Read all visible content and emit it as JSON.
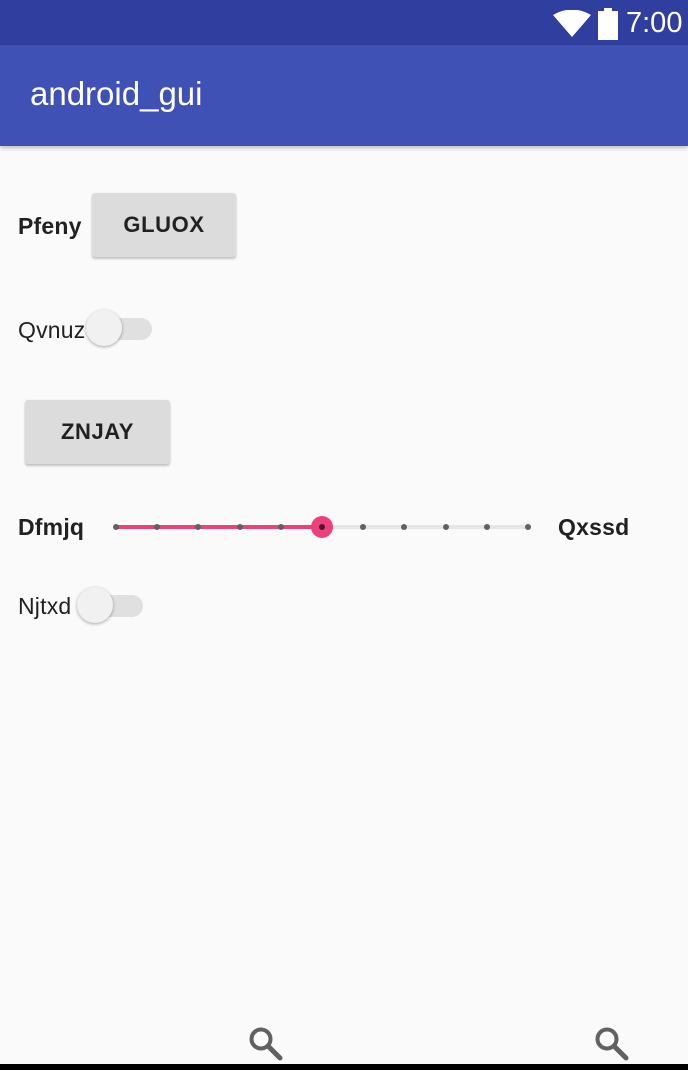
{
  "status_bar": {
    "time": "7:00",
    "icons": [
      "wifi-icon",
      "battery-icon"
    ]
  },
  "app_bar": {
    "title": "android_gui"
  },
  "rows": {
    "row1": {
      "label": "Pfeny",
      "button": "GLUOX"
    },
    "row2": {
      "label": "Qvnuz",
      "switch_on": false
    },
    "row3": {
      "button": "ZNJAY"
    },
    "row4": {
      "left_label": "Dfmjq",
      "right_label": "Qxssd",
      "steps": 10,
      "value": 5
    },
    "row5": {
      "label": "Njtxd",
      "switch_on": false
    }
  },
  "bottom_icons": [
    "search-icon",
    "search-icon"
  ],
  "colors": {
    "status_bar": "#303f9f",
    "app_bar": "#3f51b5",
    "accent": "#f0407a",
    "background": "#fafafa"
  }
}
